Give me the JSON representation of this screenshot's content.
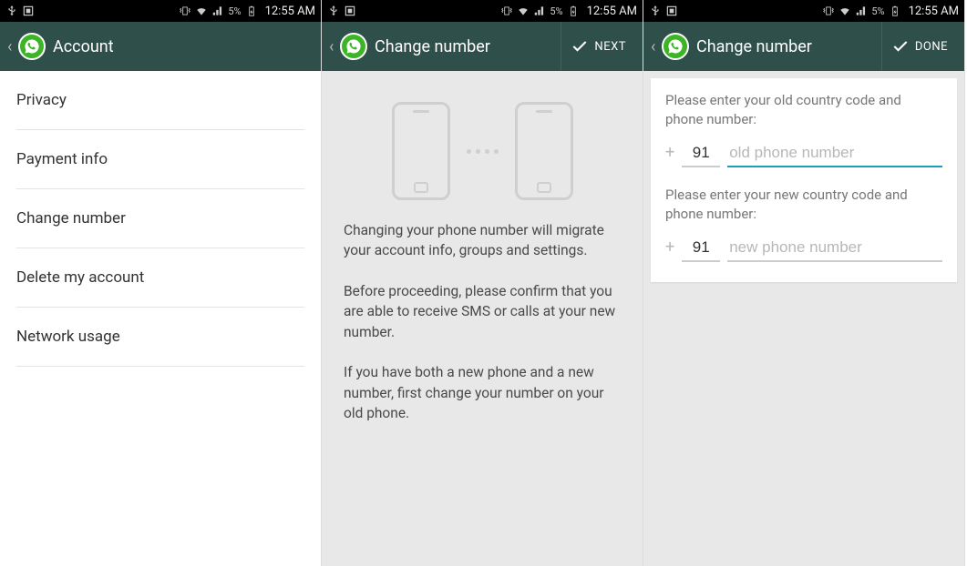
{
  "status": {
    "battery_pct": "5%",
    "time": "12:55 AM"
  },
  "screen1": {
    "title": "Account",
    "items": [
      "Privacy",
      "Payment info",
      "Change number",
      "Delete my account",
      "Network usage"
    ]
  },
  "screen2": {
    "title": "Change number",
    "action": "NEXT",
    "p1": "Changing your phone number will migrate your account info, groups and settings.",
    "p2": "Before proceeding, please confirm that you are able to receive SMS or calls at your new number.",
    "p3": "If you have both a new phone and a new number, first change your number on your old phone."
  },
  "screen3": {
    "title": "Change number",
    "action": "DONE",
    "prompt_old": "Please enter your old country code and phone number:",
    "prompt_new": "Please enter your new country code and phone number:",
    "cc_old": "91",
    "cc_new": "91",
    "ph_old_placeholder": "old phone number",
    "ph_new_placeholder": "new phone number"
  }
}
